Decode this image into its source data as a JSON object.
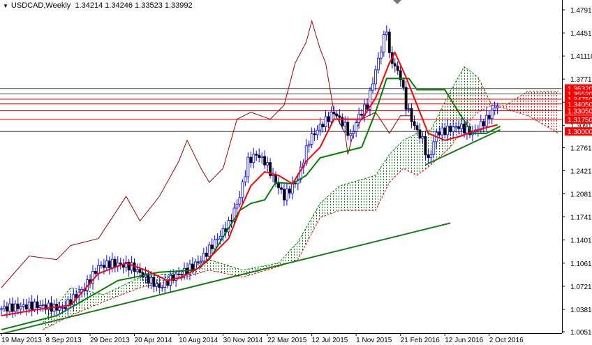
{
  "header": {
    "symbol": "USDCAD,Weekly",
    "ohlc": "1.34214 1.34246 1.33523 1.33992"
  },
  "colors": {
    "candle": "#0000ff",
    "tenkan": "#ff0000",
    "kijun": "#008000",
    "chikou": "#a00000",
    "cloud_up": "#008000",
    "cloud_down": "#ff0000",
    "level": "#ff0000",
    "level_dark": "#404040",
    "trend": "#1a7a1a"
  },
  "chart_data": {
    "type": "candlestick",
    "title": "USDCAD,Weekly",
    "ylim": [
      1.0051,
      1.4791
    ],
    "y_ticks": [
      "1.47910",
      "1.44510",
      "1.41110",
      "1.37710",
      "1.34310",
      "1.30910",
      "1.27610",
      "1.24210",
      "1.20810",
      "1.17410",
      "1.14010",
      "1.10610",
      "1.07210",
      "1.03810",
      "1.00510"
    ],
    "x_labels": [
      "19 May 2013",
      "8 Sep 2013",
      "29 Dec 2013",
      "20 Apr 2014",
      "10 Aug 2014",
      "30 Nov 2014",
      "22 Mar 2015",
      "12 Jul 2015",
      "1 Nov 2015",
      "21 Feb 2016",
      "12 Jun 2016",
      "2 Oct 2016"
    ],
    "close_anchors": [
      [
        0,
        1.0391
      ],
      [
        12,
        1.0442
      ],
      [
        22,
        1.0391
      ],
      [
        30,
        1.07
      ],
      [
        35,
        1.101
      ],
      [
        40,
        1.1062
      ],
      [
        47,
        1.101
      ],
      [
        52,
        1.0855
      ],
      [
        57,
        1.07
      ],
      [
        62,
        1.0855
      ],
      [
        67,
        1.0958
      ],
      [
        72,
        1.1113
      ],
      [
        77,
        1.1372
      ],
      [
        82,
        1.163
      ],
      [
        86,
        1.2043
      ],
      [
        89,
        1.256
      ],
      [
        92,
        1.2663
      ],
      [
        95,
        1.256
      ],
      [
        99,
        1.225
      ],
      [
        102,
        1.2043
      ],
      [
        107,
        1.2301
      ],
      [
        111,
        1.287
      ],
      [
        115,
        1.3076
      ],
      [
        120,
        1.3283
      ],
      [
        124,
        1.3076
      ],
      [
        126,
        1.2921
      ],
      [
        129,
        1.3231
      ],
      [
        132,
        1.3386
      ],
      [
        135,
        1.3903
      ],
      [
        139,
        1.4522
      ],
      [
        140,
        1.4109
      ],
      [
        144,
        1.3799
      ],
      [
        146,
        1.3386
      ],
      [
        149,
        1.3076
      ],
      [
        152,
        1.287
      ],
      [
        154,
        1.256
      ],
      [
        157,
        1.2973
      ],
      [
        161,
        1.3025
      ],
      [
        165,
        1.3076
      ],
      [
        170,
        1.2973
      ],
      [
        175,
        1.318
      ],
      [
        179,
        1.3399
      ]
    ],
    "tenkan": [
      [
        0,
        1.0288
      ],
      [
        15,
        1.0391
      ],
      [
        25,
        1.0442
      ],
      [
        35,
        1.0907
      ],
      [
        45,
        1.1062
      ],
      [
        52,
        1.0958
      ],
      [
        60,
        1.0803
      ],
      [
        65,
        1.0855
      ],
      [
        72,
        1.101
      ],
      [
        82,
        1.1423
      ],
      [
        86,
        1.1837
      ],
      [
        90,
        1.2198
      ],
      [
        95,
        1.2405
      ],
      [
        100,
        1.2353
      ],
      [
        105,
        1.2229
      ],
      [
        110,
        1.256
      ],
      [
        115,
        1.2767
      ],
      [
        120,
        1.318
      ],
      [
        125,
        1.318
      ],
      [
        130,
        1.318
      ],
      [
        135,
        1.349
      ],
      [
        140,
        1.4006
      ],
      [
        142,
        1.4161
      ],
      [
        146,
        1.3799
      ],
      [
        150,
        1.3386
      ],
      [
        154,
        1.2973
      ],
      [
        160,
        1.287
      ],
      [
        165,
        1.2921
      ],
      [
        172,
        1.3025
      ],
      [
        179,
        1.3097
      ]
    ],
    "kijun": [
      [
        0,
        1.0081
      ],
      [
        20,
        1.0288
      ],
      [
        42,
        1.0804
      ],
      [
        57,
        1.0928
      ],
      [
        70,
        1.0958
      ],
      [
        75,
        1.1113
      ],
      [
        86,
        1.1837
      ],
      [
        90,
        1.194
      ],
      [
        95,
        1.1992
      ],
      [
        99,
        1.225
      ],
      [
        105,
        1.2229
      ],
      [
        110,
        1.2353
      ],
      [
        115,
        1.2611
      ],
      [
        125,
        1.2715
      ],
      [
        130,
        1.2767
      ],
      [
        135,
        1.3283
      ],
      [
        139,
        1.3779
      ],
      [
        147,
        1.3779
      ],
      [
        150,
        1.3614
      ],
      [
        160,
        1.3614
      ],
      [
        165,
        1.3283
      ],
      [
        170,
        1.2973
      ],
      [
        175,
        1.2973
      ],
      [
        180,
        1.3076
      ]
    ],
    "chikou": [
      [
        0,
        1.07
      ],
      [
        10,
        1.1165
      ],
      [
        20,
        1.1113
      ],
      [
        25,
        1.132
      ],
      [
        35,
        1.1423
      ],
      [
        40,
        1.1733
      ],
      [
        45,
        1.2043
      ],
      [
        50,
        1.1682
      ],
      [
        57,
        1.2043
      ],
      [
        64,
        1.256
      ],
      [
        67,
        1.287
      ],
      [
        72,
        1.2457
      ],
      [
        75,
        1.225
      ],
      [
        80,
        1.2457
      ],
      [
        85,
        1.318
      ],
      [
        90,
        1.3283
      ],
      [
        97,
        1.318
      ],
      [
        102,
        1.3386
      ],
      [
        106,
        1.4006
      ],
      [
        110,
        1.4316
      ],
      [
        112,
        1.4626
      ],
      [
        115,
        1.4213
      ],
      [
        117,
        1.4006
      ],
      [
        120,
        1.3283
      ],
      [
        124,
        1.2973
      ],
      [
        125,
        1.2663
      ],
      [
        127,
        1.2973
      ],
      [
        130,
        1.318
      ],
      [
        135,
        1.3283
      ],
      [
        140,
        1.2973
      ],
      [
        144,
        1.3231
      ],
      [
        148,
        1.3231
      ]
    ],
    "cloud": [
      [
        15,
        1.0081,
        1.0185
      ],
      [
        25,
        1.0288,
        1.07
      ],
      [
        37,
        1.0494,
        1.0597
      ],
      [
        50,
        1.07,
        1.0855
      ],
      [
        62,
        1.0803,
        1.0907
      ],
      [
        75,
        1.0958,
        1.1113
      ],
      [
        87,
        1.0855,
        1.0958
      ],
      [
        100,
        1.101,
        1.1062
      ],
      [
        107,
        1.1113,
        1.1372
      ],
      [
        115,
        1.1733,
        1.194
      ],
      [
        122,
        1.1837,
        1.2198
      ],
      [
        135,
        1.1837,
        1.2353
      ],
      [
        140,
        1.225,
        1.2663
      ],
      [
        145,
        1.2457,
        1.287
      ],
      [
        150,
        1.2353,
        1.2973
      ],
      [
        155,
        1.2508,
        1.3025
      ],
      [
        162,
        1.2767,
        1.3593
      ],
      [
        167,
        1.3076,
        1.3954
      ],
      [
        172,
        1.3283,
        1.3799
      ],
      [
        177,
        1.3386,
        1.3386
      ],
      [
        182,
        1.3335,
        1.3386
      ],
      [
        190,
        1.3231,
        1.3593
      ],
      [
        201,
        1.2973,
        1.3593
      ]
    ],
    "trendlines": [
      [
        [
          0,
          1.0019
        ],
        [
          162,
          1.1651
        ]
      ],
      [
        [
          153,
          1.2508
        ],
        [
          180,
          1.3025
        ]
      ]
    ],
    "levels": [
      {
        "price": 1.3632,
        "label": "1.36320",
        "dark": true
      },
      {
        "price": 1.3552,
        "label": "1.35520",
        "dark": true
      },
      {
        "price": 1.3475,
        "label": "1.34750",
        "dark": false
      },
      {
        "price": 1.3405,
        "label": "1.34050",
        "dark": false
      },
      {
        "price": 1.3305,
        "label": "1.33050",
        "dark": false
      },
      {
        "price": 1.3175,
        "label": "1.31750",
        "dark": false
      },
      {
        "price": 1.3,
        "label": "1.30000",
        "dark": true
      }
    ]
  }
}
